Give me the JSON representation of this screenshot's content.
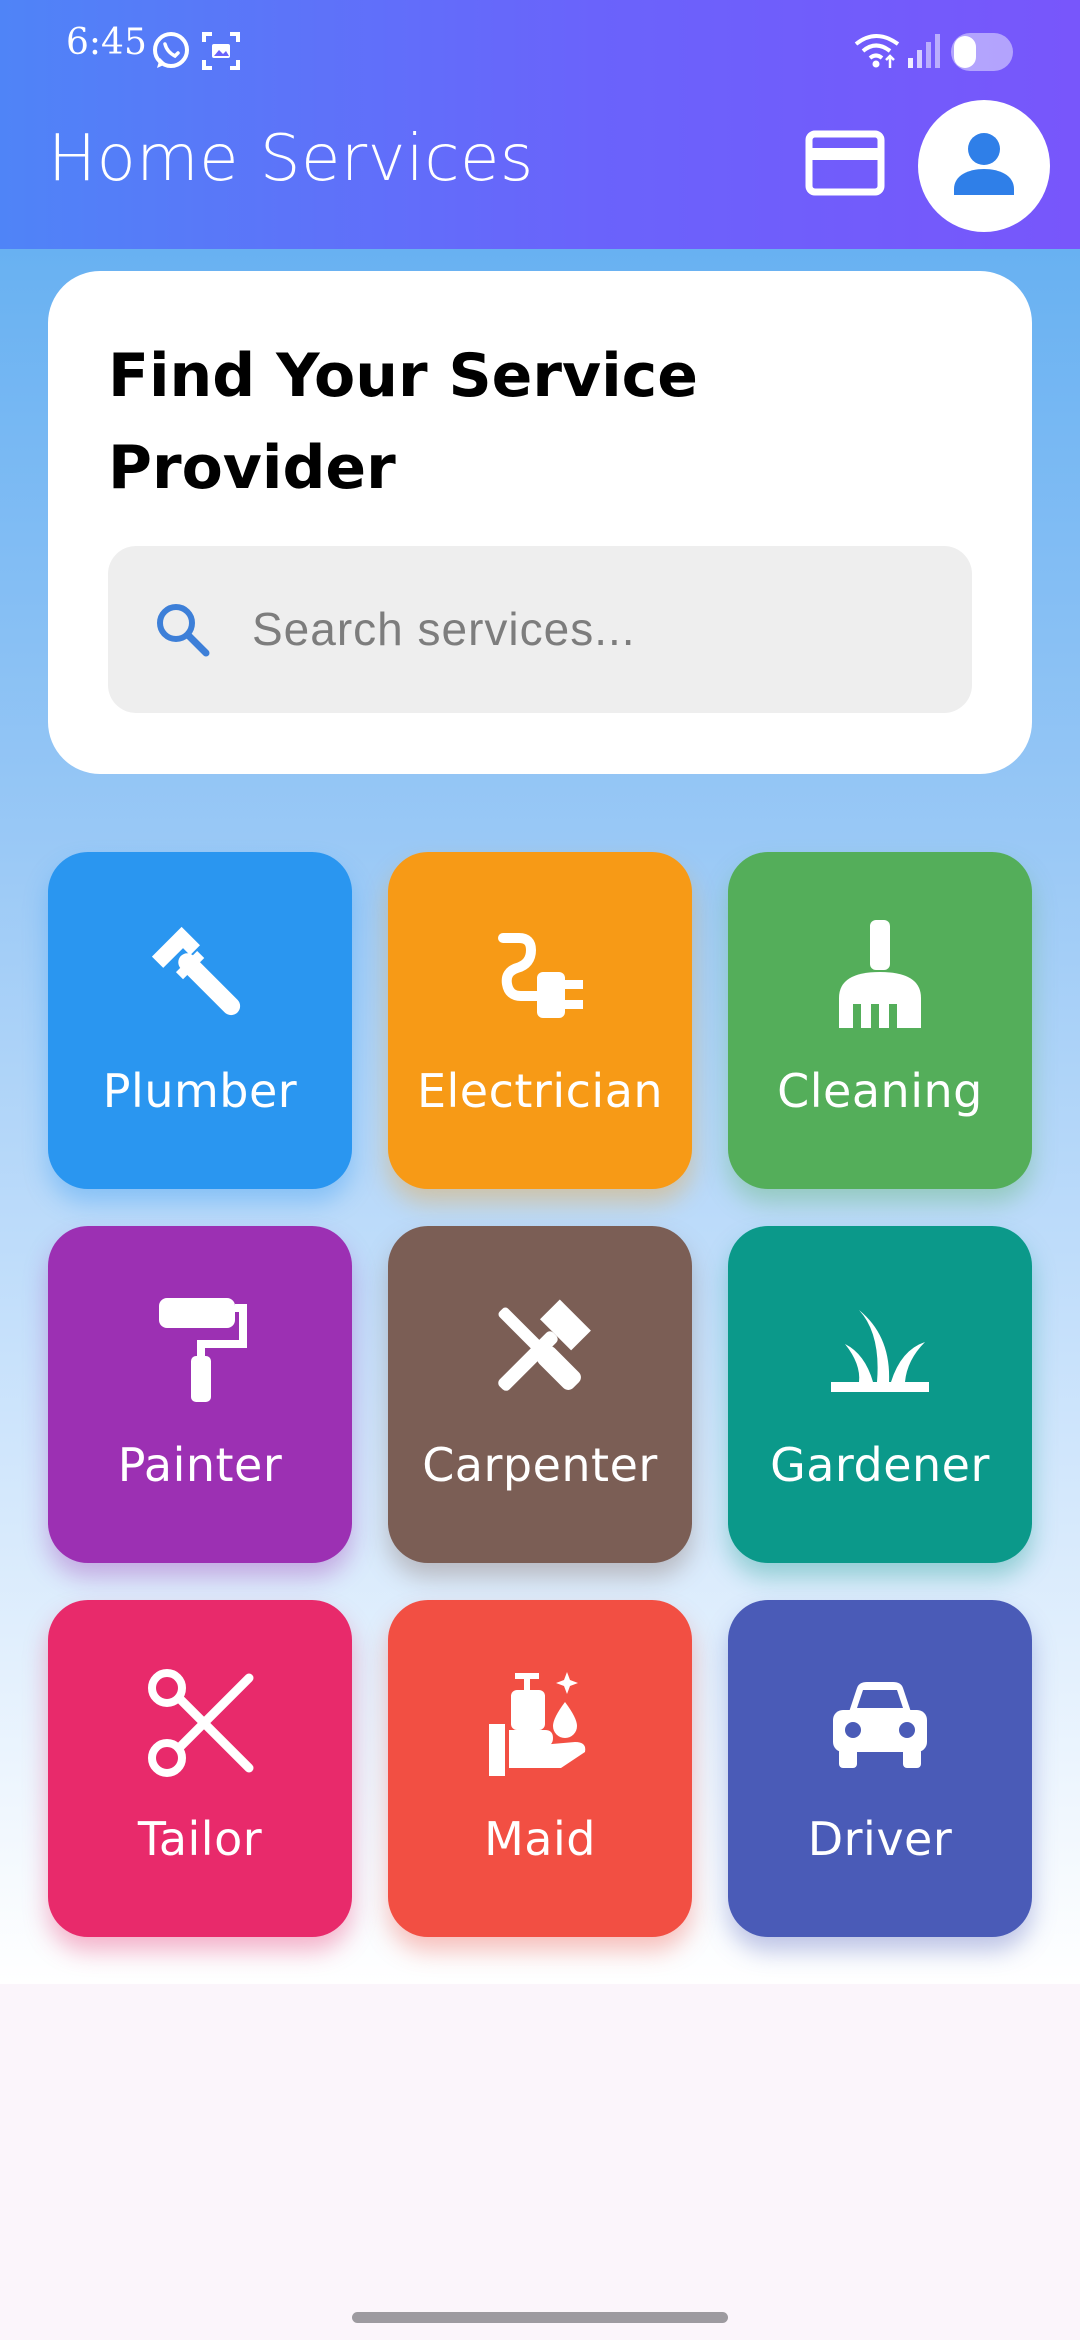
{
  "status_bar": {
    "time": "6:45",
    "icons": [
      "whatsapp-icon",
      "screenshot-icon",
      "wifi-icon",
      "signal-icon",
      "battery-icon"
    ]
  },
  "app_bar": {
    "title": "Home Services",
    "actions": [
      "payment-card-icon",
      "account-icon"
    ],
    "gradient": [
      "#4f84f7",
      "#7856fb"
    ]
  },
  "hero": {
    "title": "Find Your Service\nProvider",
    "search": {
      "placeholder": "Search services...",
      "value": "",
      "icon": "search-icon",
      "icon_color": "#3d7fd8"
    }
  },
  "services": [
    {
      "label": "Plumber",
      "icon": "wrench-icon",
      "color": "#2a96f0"
    },
    {
      "label": "Electrician",
      "icon": "plug-icon",
      "color": "#f79a16"
    },
    {
      "label": "Cleaning",
      "icon": "broom-icon",
      "color": "#54ae5a"
    },
    {
      "label": "Painter",
      "icon": "paint-roller-icon",
      "color": "#9c30b3"
    },
    {
      "label": "Carpenter",
      "icon": "tools-icon",
      "color": "#7b5e55"
    },
    {
      "label": "Gardener",
      "icon": "grass-icon",
      "color": "#0b998a"
    },
    {
      "label": "Tailor",
      "icon": "scissors-icon",
      "color": "#e82a6b"
    },
    {
      "label": "Maid",
      "icon": "hand-soap-icon",
      "color": "#f24f43"
    },
    {
      "label": "Driver",
      "icon": "car-icon",
      "color": "#4a5bb7"
    }
  ]
}
